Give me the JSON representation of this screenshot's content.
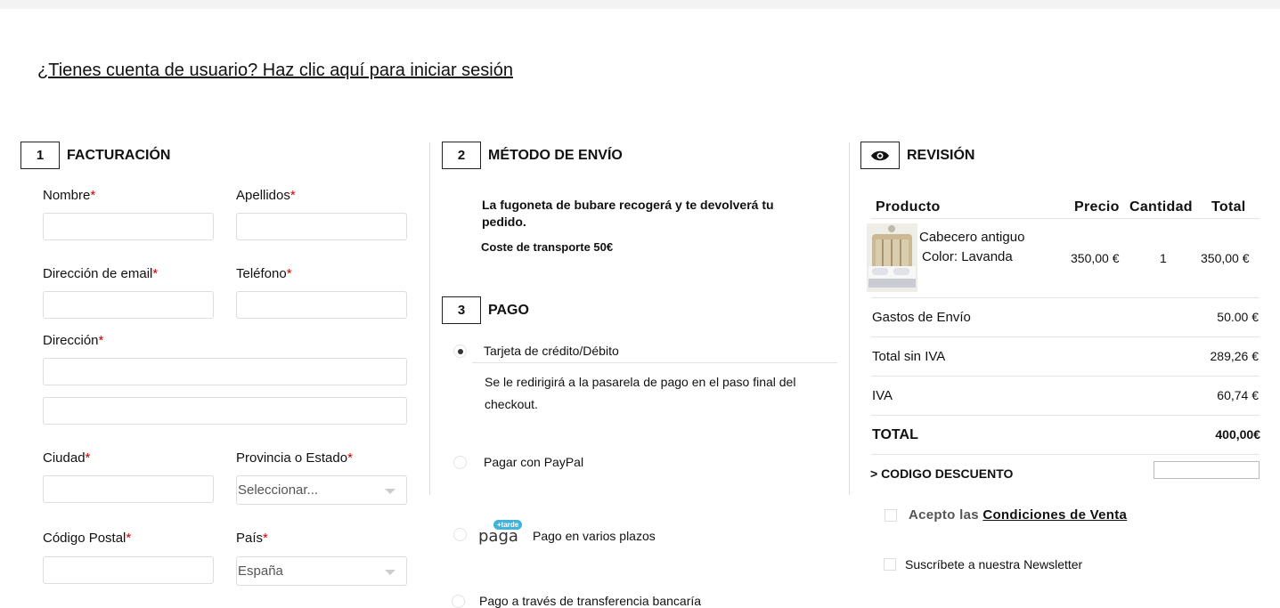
{
  "login_prompt": "¿Tienes cuenta de usuario? Haz clic aquí para iniciar sesión",
  "billing": {
    "number": "1",
    "title": "FACTURACIÓN",
    "required_mark": "*",
    "fields": {
      "nombre": "Nombre",
      "apellidos": "Apellidos",
      "email": "Dirección de email",
      "telefono": "Teléfono",
      "direccion": "Dirección",
      "ciudad": "Ciudad",
      "provincia": "Provincia o Estado",
      "codigo_postal": "Código Postal",
      "pais": "País"
    },
    "provincia_value": "Seleccionar...",
    "pais_value": "España"
  },
  "shipping": {
    "number": "2",
    "title": "MÉTODO DE ENVÍO",
    "description": "La fugoneta de bubare recogerá y te devolverá tu pedido.",
    "cost": "Coste de transporte 50€"
  },
  "payment": {
    "number": "3",
    "title": "PAGO",
    "options": [
      {
        "label": "Tarjeta de crédito/Débito",
        "selected": true
      },
      {
        "label": "Pagar con PayPal",
        "selected": false
      },
      {
        "label": "Pago en varios plazos",
        "selected": false
      },
      {
        "label": "Pago a través de transferencia bancaría",
        "selected": false
      }
    ],
    "card_note": "Se le redirigirá a la pasarela de pago en el paso final del checkout.",
    "paga_logo": "paga",
    "paga_badge": "+tarde"
  },
  "review": {
    "title": "REVISIÓN",
    "icon": "eye-icon",
    "headers": {
      "product": "Producto",
      "price": "Precio",
      "qty": "Cantidad",
      "total": "Total"
    },
    "item": {
      "name": "Cabecero antiguo",
      "color_label": "Color:",
      "color_value": "Lavanda",
      "price": "350,00 €",
      "qty": "1",
      "total": "350,00 €"
    },
    "summary": [
      {
        "label": "Gastos de Envío",
        "value": "50.00 €",
        "bold": false
      },
      {
        "label": "Total sin IVA",
        "value": "289,26 €",
        "bold": false
      },
      {
        "label": "IVA",
        "value": "60,74 €",
        "bold": false
      },
      {
        "label": "TOTAL",
        "value": "400,00€",
        "bold": true
      }
    ],
    "discount_label": "> CODIGO DESCUENTO",
    "terms_prefix": "Acepto las",
    "terms_link": "Condiciones de Venta",
    "newsletter": "Suscríbete a nuestra Newsletter"
  },
  "colors": {
    "required": "#cc0000",
    "paga_badge": "#3fb3d8"
  }
}
